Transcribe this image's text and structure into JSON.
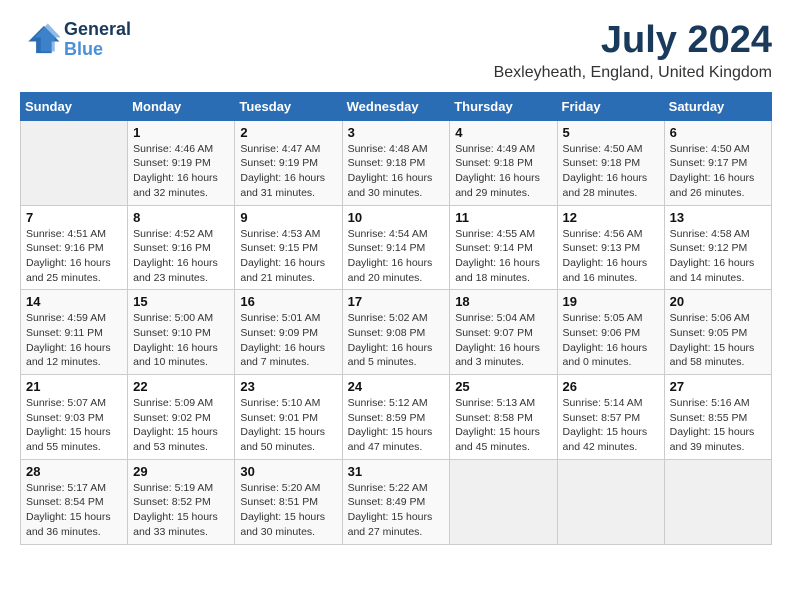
{
  "header": {
    "logo_line1": "General",
    "logo_line2": "Blue",
    "title": "July 2024",
    "subtitle": "Bexleyheath, England, United Kingdom"
  },
  "calendar": {
    "days_of_week": [
      "Sunday",
      "Monday",
      "Tuesday",
      "Wednesday",
      "Thursday",
      "Friday",
      "Saturday"
    ],
    "weeks": [
      [
        {
          "day": "",
          "info": ""
        },
        {
          "day": "1",
          "info": "Sunrise: 4:46 AM\nSunset: 9:19 PM\nDaylight: 16 hours\nand 32 minutes."
        },
        {
          "day": "2",
          "info": "Sunrise: 4:47 AM\nSunset: 9:19 PM\nDaylight: 16 hours\nand 31 minutes."
        },
        {
          "day": "3",
          "info": "Sunrise: 4:48 AM\nSunset: 9:18 PM\nDaylight: 16 hours\nand 30 minutes."
        },
        {
          "day": "4",
          "info": "Sunrise: 4:49 AM\nSunset: 9:18 PM\nDaylight: 16 hours\nand 29 minutes."
        },
        {
          "day": "5",
          "info": "Sunrise: 4:50 AM\nSunset: 9:18 PM\nDaylight: 16 hours\nand 28 minutes."
        },
        {
          "day": "6",
          "info": "Sunrise: 4:50 AM\nSunset: 9:17 PM\nDaylight: 16 hours\nand 26 minutes."
        }
      ],
      [
        {
          "day": "7",
          "info": "Sunrise: 4:51 AM\nSunset: 9:16 PM\nDaylight: 16 hours\nand 25 minutes."
        },
        {
          "day": "8",
          "info": "Sunrise: 4:52 AM\nSunset: 9:16 PM\nDaylight: 16 hours\nand 23 minutes."
        },
        {
          "day": "9",
          "info": "Sunrise: 4:53 AM\nSunset: 9:15 PM\nDaylight: 16 hours\nand 21 minutes."
        },
        {
          "day": "10",
          "info": "Sunrise: 4:54 AM\nSunset: 9:14 PM\nDaylight: 16 hours\nand 20 minutes."
        },
        {
          "day": "11",
          "info": "Sunrise: 4:55 AM\nSunset: 9:14 PM\nDaylight: 16 hours\nand 18 minutes."
        },
        {
          "day": "12",
          "info": "Sunrise: 4:56 AM\nSunset: 9:13 PM\nDaylight: 16 hours\nand 16 minutes."
        },
        {
          "day": "13",
          "info": "Sunrise: 4:58 AM\nSunset: 9:12 PM\nDaylight: 16 hours\nand 14 minutes."
        }
      ],
      [
        {
          "day": "14",
          "info": "Sunrise: 4:59 AM\nSunset: 9:11 PM\nDaylight: 16 hours\nand 12 minutes."
        },
        {
          "day": "15",
          "info": "Sunrise: 5:00 AM\nSunset: 9:10 PM\nDaylight: 16 hours\nand 10 minutes."
        },
        {
          "day": "16",
          "info": "Sunrise: 5:01 AM\nSunset: 9:09 PM\nDaylight: 16 hours\nand 7 minutes."
        },
        {
          "day": "17",
          "info": "Sunrise: 5:02 AM\nSunset: 9:08 PM\nDaylight: 16 hours\nand 5 minutes."
        },
        {
          "day": "18",
          "info": "Sunrise: 5:04 AM\nSunset: 9:07 PM\nDaylight: 16 hours\nand 3 minutes."
        },
        {
          "day": "19",
          "info": "Sunrise: 5:05 AM\nSunset: 9:06 PM\nDaylight: 16 hours\nand 0 minutes."
        },
        {
          "day": "20",
          "info": "Sunrise: 5:06 AM\nSunset: 9:05 PM\nDaylight: 15 hours\nand 58 minutes."
        }
      ],
      [
        {
          "day": "21",
          "info": "Sunrise: 5:07 AM\nSunset: 9:03 PM\nDaylight: 15 hours\nand 55 minutes."
        },
        {
          "day": "22",
          "info": "Sunrise: 5:09 AM\nSunset: 9:02 PM\nDaylight: 15 hours\nand 53 minutes."
        },
        {
          "day": "23",
          "info": "Sunrise: 5:10 AM\nSunset: 9:01 PM\nDaylight: 15 hours\nand 50 minutes."
        },
        {
          "day": "24",
          "info": "Sunrise: 5:12 AM\nSunset: 8:59 PM\nDaylight: 15 hours\nand 47 minutes."
        },
        {
          "day": "25",
          "info": "Sunrise: 5:13 AM\nSunset: 8:58 PM\nDaylight: 15 hours\nand 45 minutes."
        },
        {
          "day": "26",
          "info": "Sunrise: 5:14 AM\nSunset: 8:57 PM\nDaylight: 15 hours\nand 42 minutes."
        },
        {
          "day": "27",
          "info": "Sunrise: 5:16 AM\nSunset: 8:55 PM\nDaylight: 15 hours\nand 39 minutes."
        }
      ],
      [
        {
          "day": "28",
          "info": "Sunrise: 5:17 AM\nSunset: 8:54 PM\nDaylight: 15 hours\nand 36 minutes."
        },
        {
          "day": "29",
          "info": "Sunrise: 5:19 AM\nSunset: 8:52 PM\nDaylight: 15 hours\nand 33 minutes."
        },
        {
          "day": "30",
          "info": "Sunrise: 5:20 AM\nSunset: 8:51 PM\nDaylight: 15 hours\nand 30 minutes."
        },
        {
          "day": "31",
          "info": "Sunrise: 5:22 AM\nSunset: 8:49 PM\nDaylight: 15 hours\nand 27 minutes."
        },
        {
          "day": "",
          "info": ""
        },
        {
          "day": "",
          "info": ""
        },
        {
          "day": "",
          "info": ""
        }
      ]
    ]
  }
}
